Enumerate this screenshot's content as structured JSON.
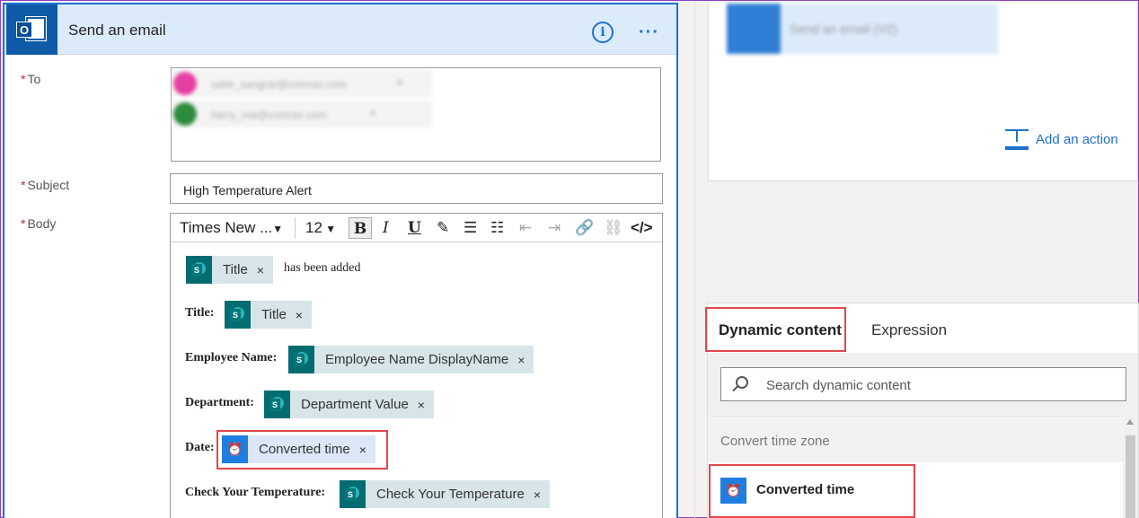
{
  "action": {
    "title": "Send an email",
    "fields": {
      "to_label": "To",
      "subject_label": "Subject",
      "body_label": "Body",
      "subject_value": "High Temperature Alert"
    },
    "recipients": [
      "sahir_sangrar@comrax.com",
      "harry_rod@comrax.com"
    ],
    "toolbar": {
      "font": "Times New ...",
      "size": "12"
    },
    "body": {
      "line1_suffix": "has been added",
      "title_label": "Title:",
      "employee_label": "Employee Name:",
      "department_label": "Department:",
      "date_label": "Date:",
      "temp_label": "Check Your Temperature:",
      "tokens": {
        "title": "Title",
        "title2": "Title",
        "employee": "Employee Name DisplayName",
        "department": "Department Value",
        "converted": "Converted time",
        "temperature": "Check Your Temperature"
      },
      "token_remove": "×"
    }
  },
  "right": {
    "blurred_action": "Send an email (V2)",
    "add_action": "Add an action"
  },
  "dynamic_panel": {
    "tabs": [
      "Dynamic content",
      "Expression"
    ],
    "search_placeholder": "Search dynamic content",
    "group": "Convert time zone",
    "item": "Converted time"
  },
  "colors": {
    "accent": "#1f6fd1",
    "highlight": "#e0474c",
    "sharepoint": "#036c70"
  }
}
